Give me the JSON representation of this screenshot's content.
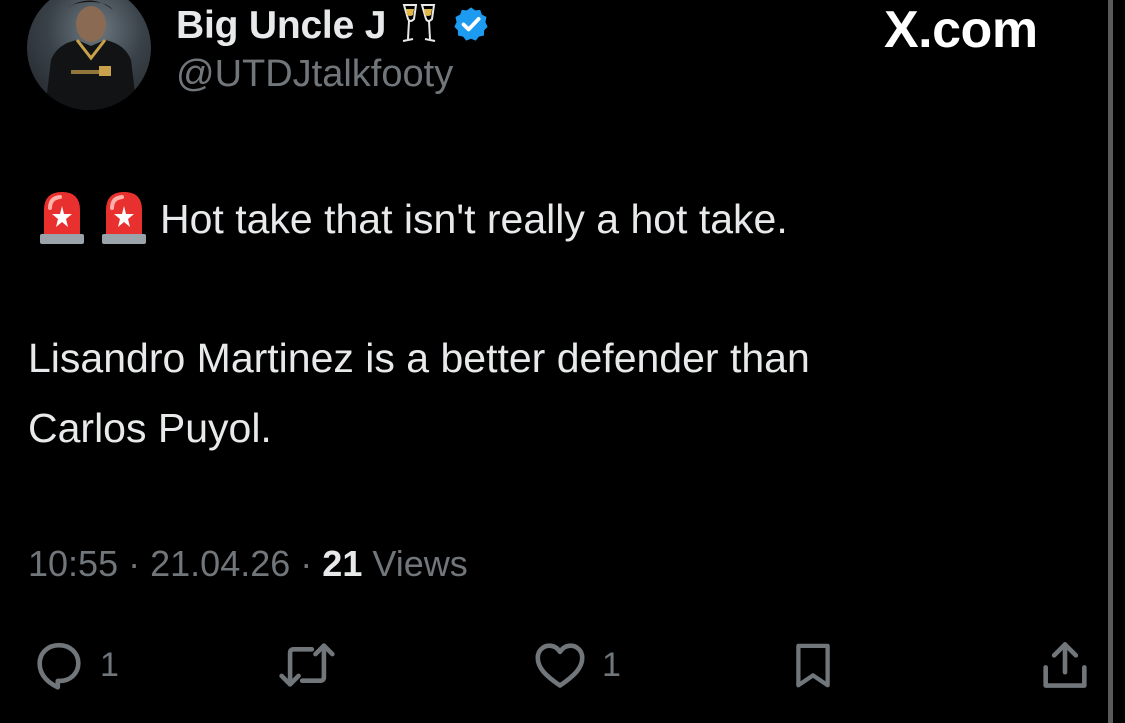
{
  "header": {
    "display_name": "Big Uncle J",
    "name_emoji": "🥂",
    "verified": true,
    "handle": "@UTDJtalkfooty",
    "brand": "X.com"
  },
  "tweet": {
    "line1_emojis": [
      "🚨",
      "🚨"
    ],
    "line1_text": "Hot take that isn't really a hot take.",
    "line2_text": "Lisandro Martinez is a better defender than",
    "line3_text": "Carlos Puyol."
  },
  "meta": {
    "time": "10:55",
    "separator": "·",
    "date": "21.04.26",
    "views_count": "21",
    "views_label": "Views"
  },
  "actions": {
    "reply_count": "1",
    "like_count": "1"
  },
  "colors": {
    "background": "#000000",
    "text": "#e7e9ea",
    "muted": "#71767b",
    "verified": "#1d9bf0"
  }
}
